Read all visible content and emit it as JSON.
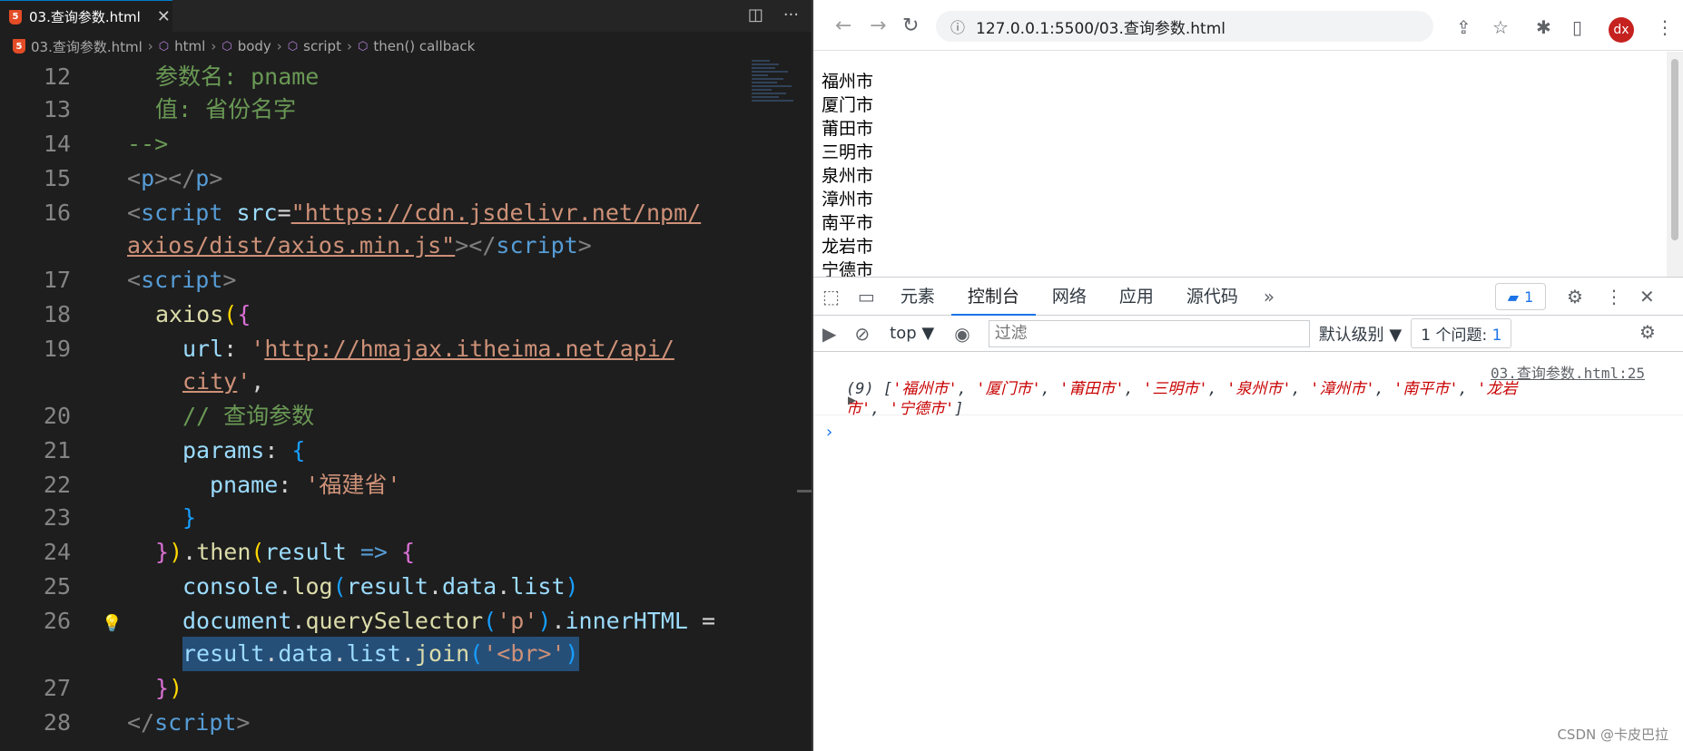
{
  "editor": {
    "tab": "03.查询参数.html",
    "breadcrumb": [
      "03.查询参数.html",
      "html",
      "body",
      "script",
      "then() callback"
    ]
  },
  "browser": {
    "url": "127.0.0.1:5500/03.查询参数.html",
    "avatar": "dx",
    "cities": [
      "福州市",
      "厦门市",
      "莆田市",
      "三明市",
      "泉州市",
      "漳州市",
      "南平市",
      "龙岩市",
      "宁德市"
    ]
  },
  "devtools": {
    "tabs": [
      "元素",
      "控制台",
      "网络",
      "应用",
      "源代码"
    ],
    "issues_badge": "1",
    "context": "top",
    "filter_placeholder": "过滤",
    "level": "默认级别",
    "issues_label": "1 个问题:",
    "issues_num": "1",
    "log_source": "03.查询参数.html:25",
    "log_count": "(9)"
  },
  "watermark": "CSDN @卡皮巴拉"
}
